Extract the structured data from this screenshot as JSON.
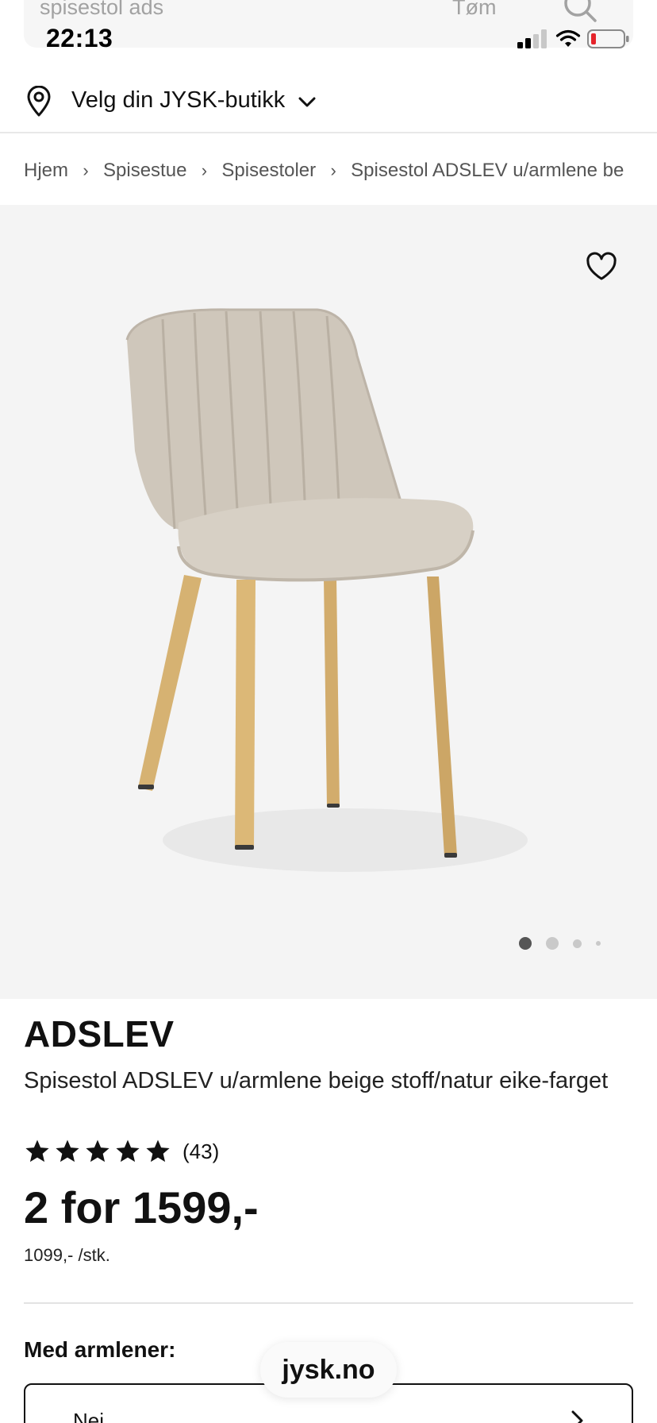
{
  "search": {
    "query": "spisestol ads",
    "clear_label": "Tøm"
  },
  "status_bar": {
    "time": "22:13"
  },
  "store": {
    "label": "Velg din JYSK-butikk"
  },
  "breadcrumb": {
    "items": [
      "Hjem",
      "Spisestue",
      "Spisestoler",
      "Spisestol ADSLEV u/armlene be"
    ]
  },
  "gallery": {
    "image_alt": "Spisestol ADSLEV",
    "slides": 4,
    "active_slide": 1
  },
  "product": {
    "brand": "ADSLEV",
    "name": "Spisestol ADSLEV u/armlene beige stoff/natur eike-farget",
    "rating": 5,
    "rating_count": "(43)",
    "price": "2 for 1599,-",
    "unit_price": "1099,- /stk."
  },
  "options": {
    "label": "Med armlener:",
    "value": "Nei"
  },
  "browser": {
    "domain": "jysk.no"
  },
  "colors": {
    "text": "#111111",
    "muted": "#555555",
    "gallery_bg": "#f4f4f4",
    "battery_low": "#e5242b"
  }
}
